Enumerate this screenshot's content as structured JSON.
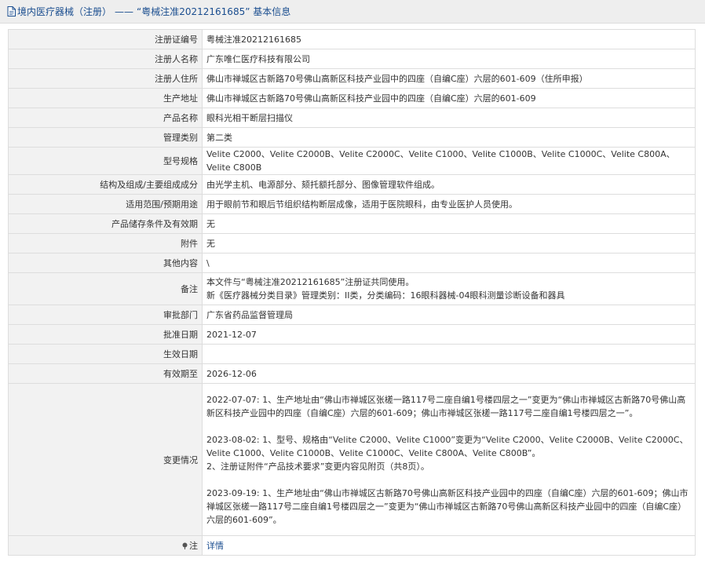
{
  "header": {
    "category": "境内医疗器械（注册）",
    "separator": "——",
    "title": "“粤械注准20212161685” 基本信息"
  },
  "rows": [
    {
      "label": "注册证编号",
      "value": "粤械注准20212161685"
    },
    {
      "label": "注册人名称",
      "value": "广东唯仁医疗科技有限公司"
    },
    {
      "label": "注册人住所",
      "value": "佛山市禅城区古新路70号佛山高新区科技产业园中的四座（自编C座）六层的601-609（住所申报）"
    },
    {
      "label": "生产地址",
      "value": "佛山市禅城区古新路70号佛山高新区科技产业园中的四座（自编C座）六层的601-609"
    },
    {
      "label": "产品名称",
      "value": "眼科光相干断层扫描仪"
    },
    {
      "label": "管理类别",
      "value": "第二类"
    },
    {
      "label": "型号规格",
      "value": "Velite C2000、Velite C2000B、Velite C2000C、Velite C1000、Velite C1000B、Velite C1000C、Velite C800A、Velite C800B"
    },
    {
      "label": "结构及组成/主要组成成分",
      "value": "由光学主机、电源部分、颏托额托部分、图像管理软件组成。"
    },
    {
      "label": "适用范围/预期用途",
      "value": "用于眼前节和眼后节组织结构断层成像，适用于医院眼科，由专业医护人员使用。"
    },
    {
      "label": "产品储存条件及有效期",
      "value": "无"
    },
    {
      "label": "附件",
      "value": "无"
    },
    {
      "label": "其他内容",
      "value": "\\"
    }
  ],
  "remark": {
    "label": "备注",
    "line1": "本文件与“粤械注准20212161685”注册证共同使用。",
    "line2": "新《医疗器械分类目录》管理类别：II类，分类编码：16眼科器械-04眼科测量诊断设备和器具"
  },
  "rows2": [
    {
      "label": "审批部门",
      "value": "广东省药品监督管理局"
    },
    {
      "label": "批准日期",
      "value": "2021-12-07"
    },
    {
      "label": "生效日期",
      "value": ""
    },
    {
      "label": "有效期至",
      "value": "2026-12-06"
    }
  ],
  "changes": {
    "label": "变更情况",
    "entry1": "2022-07-07: 1、生产地址由“佛山市禅城区张槎一路117号二座自编1号楼四层之一”变更为“佛山市禅城区古新路70号佛山高新区科技产业园中的四座（自编C座）六层的601-609；佛山市禅城区张槎一路117号二座自编1号楼四层之一”。",
    "entry2a": "2023-08-02: 1、型号、规格由“Velite C2000、Velite C1000”变更为“Velite C2000、Velite C2000B、Velite C2000C、Velite C1000、Velite C1000B、Velite C1000C、Velite C800A、Velite C800B”。",
    "entry2b": "2、注册证附件“产品技术要求”变更内容见附页（共8页）。",
    "entry3": "2023-09-19: 1、生产地址由“佛山市禅城区古新路70号佛山高新区科技产业园中的四座（自编C座）六层的601-609；佛山市禅城区张槎一路117号二座自编1号楼四层之一”变更为“佛山市禅城区古新路70号佛山高新区科技产业园中的四座（自编C座）六层的601-609”。"
  },
  "note": {
    "label": "注",
    "link": "详情",
    "icon": "pin-icon"
  },
  "colors": {
    "link": "#1a4d8f",
    "label_bg": "#f2f2f2",
    "border": "#dddddd"
  }
}
